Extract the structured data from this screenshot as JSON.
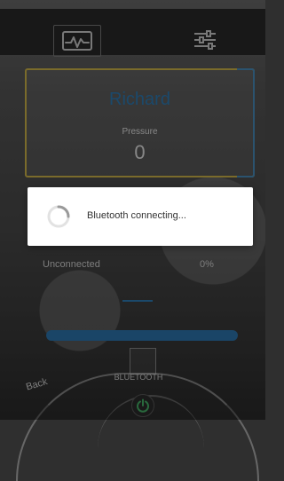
{
  "header": {
    "left_icon": "heart-rate-monitor-icon",
    "right_icon": "settings-sliders-icon"
  },
  "profile_card": {
    "name": "Richard",
    "pressure_label": "Pressure",
    "pressure_value": "0"
  },
  "status": {
    "connection": "Unconnected",
    "battery_percent": "0%"
  },
  "footer": {
    "back_label": "Back",
    "bluetooth_label": "BLUETOOTH",
    "power_icon": "power-icon"
  },
  "dialog": {
    "message": "Bluetooth connecting..."
  },
  "colors": {
    "accent_blue": "#2f7eb8",
    "card_yellow": "#d2b84b",
    "dialog_bg": "#ffffff"
  }
}
